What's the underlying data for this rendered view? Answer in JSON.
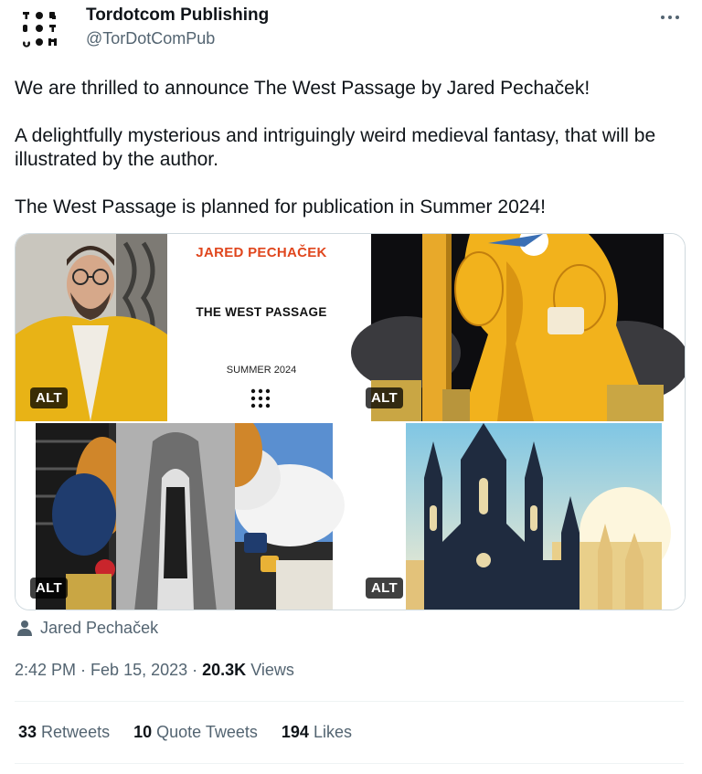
{
  "author": {
    "name": "Tordotcom Publishing",
    "handle": "@TorDotComPub",
    "avatar_letters": [
      "T",
      "O",
      "R",
      "D",
      "O",
      "T",
      "C",
      "O",
      "M"
    ]
  },
  "tweet": {
    "paragraphs": [
      "We are thrilled to announce The West Passage by Jared Pechaček!",
      "A delightfully mysterious and intriguingly weird medieval fantasy, that will be illustrated by the author.",
      "The West Passage is planned for publication in Summer 2024!"
    ]
  },
  "media": {
    "alt_label": "ALT",
    "cover": {
      "author": "JARED PECHAČEK",
      "title": "THE WEST PASSAGE",
      "date": "SUMMER 2024"
    }
  },
  "tagged_user": "Jared Pechaček",
  "meta": {
    "time": "2:42 PM",
    "separator": "·",
    "date": "Feb 15, 2023",
    "views_count": "20.3K",
    "views_label": "Views"
  },
  "stats": {
    "retweets_count": "33",
    "retweets_label": "Retweets",
    "quotes_count": "10",
    "quotes_label": "Quote Tweets",
    "likes_count": "194",
    "likes_label": "Likes"
  },
  "colors": {
    "text_primary": "#0f1419",
    "text_secondary": "#536471",
    "border": "#cfd9de",
    "cover_accent": "#e0461d",
    "jacket_yellow": "#f2b21c"
  },
  "icons": {
    "more": "more-dots-icon",
    "tagged": "person-icon"
  }
}
